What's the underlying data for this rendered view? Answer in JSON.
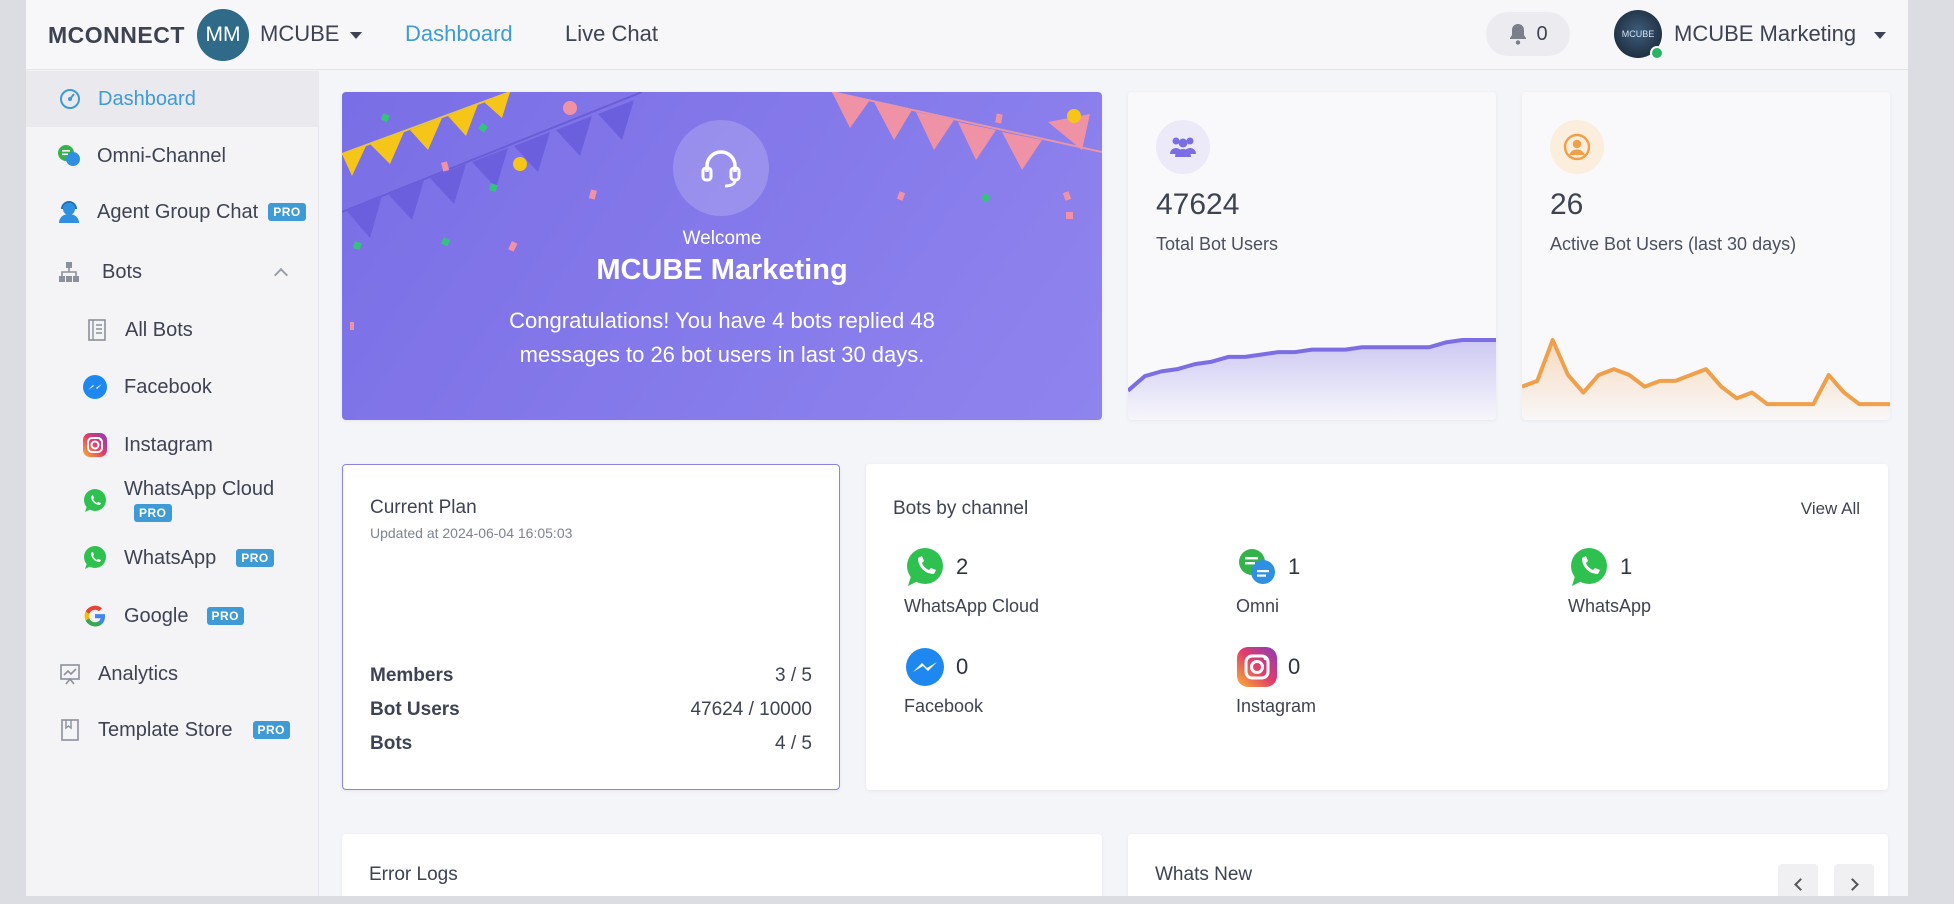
{
  "nav": {
    "brand": "MCONNECT",
    "workspace_initials": "MM",
    "workspace_name": "MCUBE",
    "links": [
      "Dashboard",
      "Live Chat"
    ],
    "notification_count": "0",
    "user_name": "MCUBE Marketing",
    "user_avatar_text": "MCUBE",
    "active_color": "#3e9bd6"
  },
  "sidebar": {
    "items": [
      {
        "label": "Dashboard",
        "icon": "dashboard-gauge-icon"
      },
      {
        "label": "Omni-Channel",
        "icon": "omni-channel-icon"
      },
      {
        "label": "Agent Group Chat",
        "badge": "PRO",
        "icon": "agent-headset-icon"
      },
      {
        "label": "Bots",
        "icon": "bots-hierarchy-icon"
      },
      {
        "label": "All Bots",
        "icon": "document-list-icon"
      },
      {
        "label": "Facebook",
        "icon": "messenger-icon"
      },
      {
        "label": "Instagram",
        "icon": "instagram-icon"
      },
      {
        "label": "WhatsApp Cloud",
        "badge": "PRO",
        "icon": "whatsapp-icon"
      },
      {
        "label": "WhatsApp",
        "badge": "PRO",
        "icon": "whatsapp-icon"
      },
      {
        "label": "Google",
        "badge": "PRO",
        "icon": "google-icon"
      },
      {
        "label": "Analytics",
        "icon": "analytics-chart-icon"
      },
      {
        "label": "Template Store",
        "badge": "PRO",
        "icon": "template-store-icon"
      }
    ]
  },
  "welcome": {
    "greeting": "Welcome",
    "name": "MCUBE Marketing",
    "message": "Congratulations! You have 4 bots replied 48 messages to 26 bot users in last 30 days."
  },
  "stats": {
    "total_users": {
      "value": "47624",
      "label": "Total Bot Users",
      "color": "#7b6ee4",
      "trend": [
        8,
        14,
        16,
        17,
        19,
        20,
        22,
        22,
        23,
        24,
        24,
        25,
        25,
        25,
        26,
        26,
        26,
        26,
        26,
        28,
        29,
        29,
        29
      ]
    },
    "active_users": {
      "value": "26",
      "label": "Active Bot Users (last 30 days)",
      "color": "#f0a04b",
      "trend": [
        4,
        5,
        12,
        6,
        3,
        6,
        7,
        6,
        4,
        5,
        5,
        6,
        7,
        4,
        2,
        3,
        1,
        1,
        1,
        1,
        6,
        3,
        1,
        1,
        1
      ]
    }
  },
  "plan": {
    "title": "Current Plan",
    "updated": "Updated at 2024-06-04 16:05:03",
    "rows": [
      {
        "label": "Members",
        "value": "3 / 5"
      },
      {
        "label": "Bot Users",
        "value": "47624 / 10000"
      },
      {
        "label": "Bots",
        "value": "4 / 5"
      }
    ]
  },
  "channels": {
    "title": "Bots by channel",
    "view_all": "View All",
    "items": [
      {
        "name": "WhatsApp Cloud",
        "count": "2",
        "icon": "whatsapp-icon"
      },
      {
        "name": "Omni",
        "count": "1",
        "icon": "omni-channel-icon"
      },
      {
        "name": "WhatsApp",
        "count": "1",
        "icon": "whatsapp-icon"
      },
      {
        "name": "Facebook",
        "count": "0",
        "icon": "messenger-icon"
      },
      {
        "name": "Instagram",
        "count": "0",
        "icon": "instagram-icon"
      }
    ]
  },
  "error_logs": {
    "title": "Error Logs"
  },
  "whats_new": {
    "title": "Whats New"
  }
}
